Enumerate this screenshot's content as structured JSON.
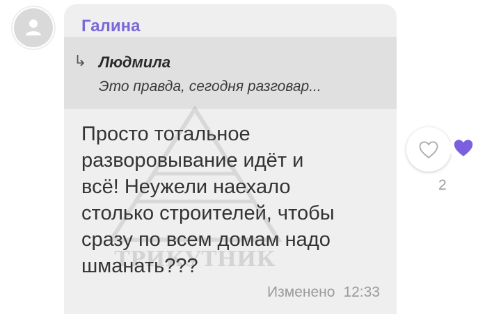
{
  "sender": {
    "name": "Галина"
  },
  "quote": {
    "author": "Людмила",
    "text": "Это правда, сегодня разговар..."
  },
  "message": {
    "lines": [
      "Просто тотальное",
      "разворовывание  идёт и",
      "всё! Неужели наехало",
      "столько строителей, чтобы",
      "сразу по всем домам надо",
      "шманать???"
    ]
  },
  "meta": {
    "edited": "Изменено",
    "time": "12:33"
  },
  "watermark": {
    "text": "ТРИКУТНИК"
  },
  "reactions": {
    "like_count": "2"
  },
  "colors": {
    "accent": "#7b68d9",
    "bubble": "#efefef",
    "quote_bg": "#e0e0e0",
    "reaction": "#7b5fe0"
  },
  "icons": [
    "avatar-person-icon",
    "reply-arrow-icon",
    "heart-outline-icon",
    "heart-filled-icon"
  ]
}
